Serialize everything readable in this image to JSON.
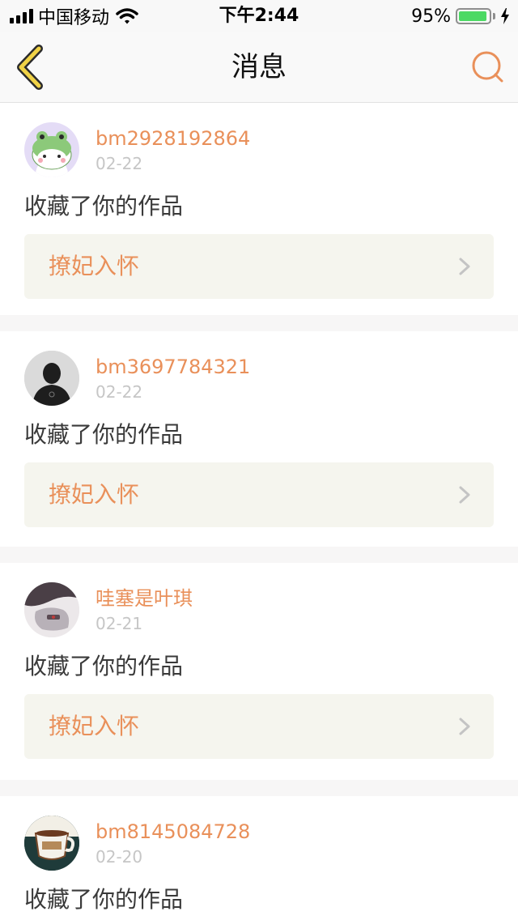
{
  "status_bar": {
    "carrier": "中国移动",
    "time": "下午2:44",
    "battery_percent": "95%",
    "battery_level": 0.95,
    "icons": [
      "signal-icon",
      "wifi-icon",
      "battery-icon",
      "charging-icon"
    ]
  },
  "nav": {
    "title": "消息",
    "back_icon": "chevron-left-icon",
    "search_icon": "search-icon"
  },
  "colors": {
    "accent": "#e9905a",
    "back_arrow": "#f0d246",
    "date": "#c6c6c6",
    "card_bg": "#ffffff",
    "link_bg": "#f5f5ee",
    "page_bg": "#f7f6f6"
  },
  "messages": [
    {
      "username": "bm2928192864",
      "date": "02-22",
      "action": "收藏了你的作品",
      "work_title": "撩妃入怀",
      "avatar_icon": "frog-avatar"
    },
    {
      "username": "bm3697784321",
      "date": "02-22",
      "action": "收藏了你的作品",
      "work_title": "撩妃入怀",
      "avatar_icon": "person-silhouette-avatar"
    },
    {
      "username": "哇塞是叶琪",
      "date": "02-21",
      "action": "收藏了你的作品",
      "work_title": "撩妃入怀",
      "avatar_icon": "photo-avatar"
    },
    {
      "username": "bm8145084728",
      "date": "02-20",
      "action": "收藏了你的作品",
      "work_title": "",
      "avatar_icon": "coffee-cup-avatar"
    }
  ]
}
